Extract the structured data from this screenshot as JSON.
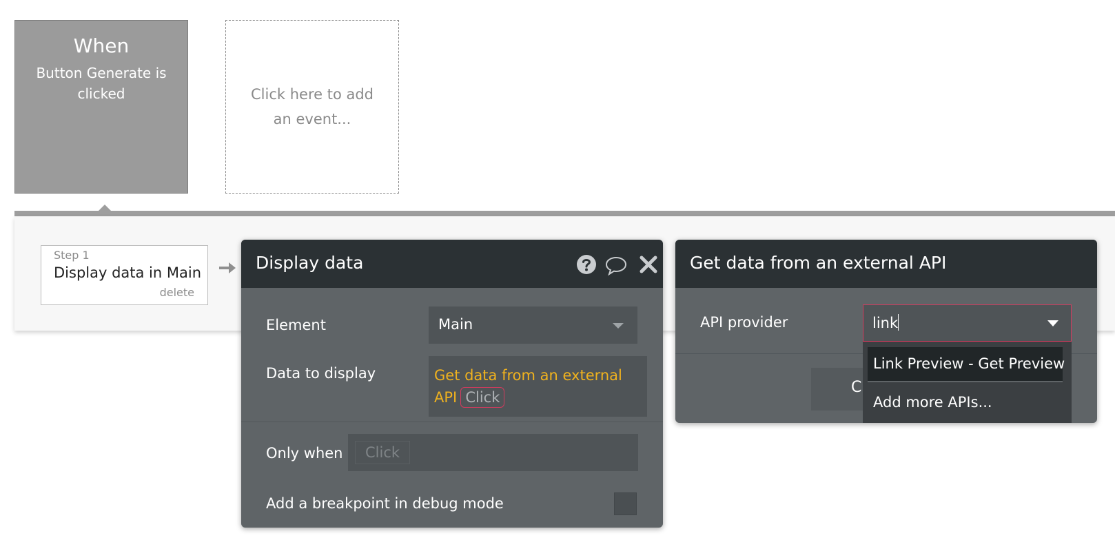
{
  "event": {
    "title": "When",
    "description": "Button Generate is clicked",
    "add_placeholder": "Click here to add an event..."
  },
  "step": {
    "number_label": "Step 1",
    "name": "Display data in Main",
    "delete_label": "delete"
  },
  "display_panel": {
    "title": "Display data",
    "element_label": "Element",
    "element_value": "Main",
    "data_label": "Data to display",
    "data_expression": "Get data from an external API",
    "data_click": "Click",
    "only_when_label": "Only when",
    "only_when_click": "Click",
    "breakpoint_label": "Add a breakpoint in debug mode",
    "icons": [
      "help-icon",
      "comment-icon",
      "close-icon"
    ]
  },
  "external_panel": {
    "title": "Get data from an external API",
    "provider_label": "API provider",
    "provider_value": "link",
    "dropdown_options": [
      "Link Preview - Get Preview",
      "Add more APIs..."
    ],
    "hidden_button_label": "C"
  },
  "colors": {
    "panel_header": "#2b3134",
    "panel_body": "#5f6467",
    "expression": "#f0b21e",
    "focus_border": "#d23b5e"
  }
}
